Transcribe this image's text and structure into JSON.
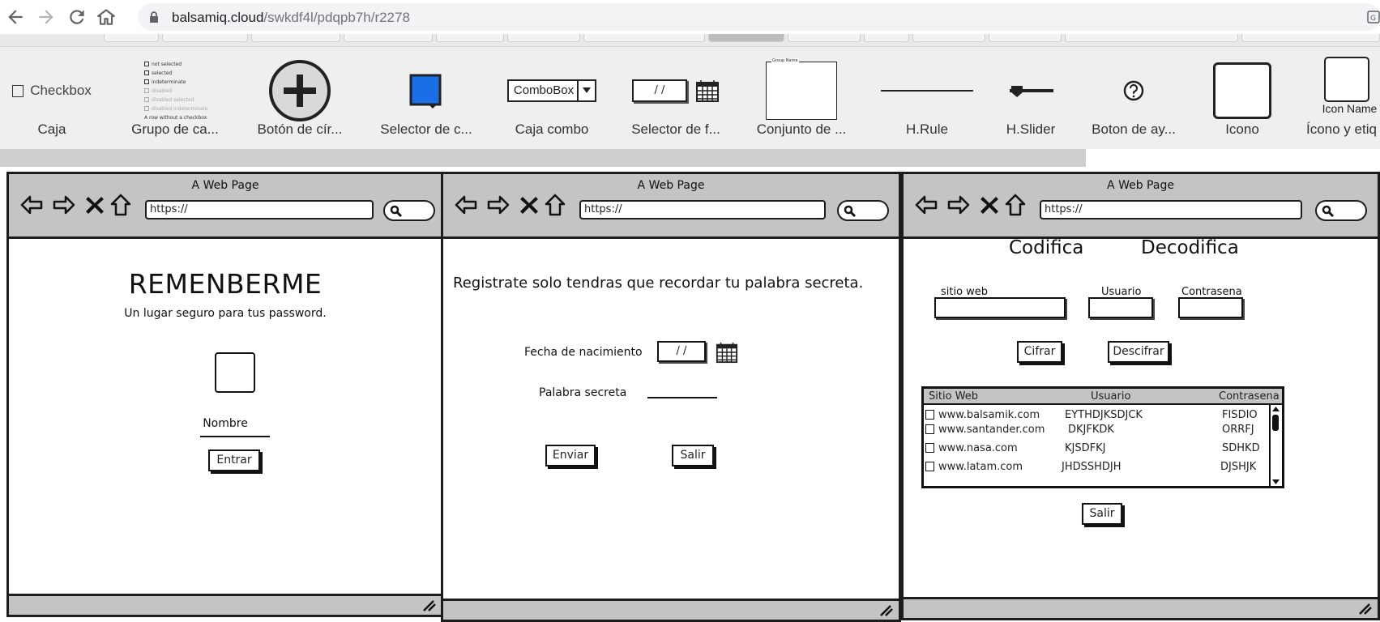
{
  "browser": {
    "url_host": "balsamiq.cloud",
    "url_path": "/swkdf4l/pdqpb7h/r2278"
  },
  "library": {
    "items": [
      {
        "label": "Caja",
        "preview_text": "Checkbox"
      },
      {
        "label": "Grupo de ca...",
        "preview_lines": [
          "not selected",
          "selected",
          "indeterminate",
          "disabled",
          "disabled selected",
          "disabled indeterminate",
          "A row without a checkbox"
        ]
      },
      {
        "label": "Botón de cír..."
      },
      {
        "label": "Selector de c..."
      },
      {
        "label": "Caja combo",
        "preview_text": "ComboBox"
      },
      {
        "label": "Selector de f...",
        "preview_text": "/ /"
      },
      {
        "label": "Conjunto de ...",
        "preview_text": "Group Name"
      },
      {
        "label": "H.Rule"
      },
      {
        "label": "H.Slider"
      },
      {
        "label": "Boton de ay..."
      },
      {
        "label": "Icono"
      },
      {
        "label": "Ícono y etiq",
        "preview_text": "Icon Name"
      }
    ]
  },
  "frames": [
    {
      "title": "A Web Page",
      "url": "https://",
      "heading": "REMENBERME",
      "subheading": "Un lugar seguro para tus password.",
      "name_label": "Nombre",
      "enter_button": "Entrar"
    },
    {
      "title": "A Web Page",
      "url": "https://",
      "intro": "Registrate solo tendras que recordar tu palabra secreta.",
      "birth_label": "Fecha de nacimiento",
      "date_value": "/ /",
      "secret_label": "Palabra secreta",
      "send_button": "Enviar",
      "exit_button": "Salir"
    },
    {
      "title": "A Web Page",
      "url": "https://",
      "encode_title": "Codifica",
      "decode_title": "Decodifica",
      "site_label": "sitio web",
      "user_label": "Usuario",
      "password_label": "Contrasena",
      "encrypt_button": "Cifrar",
      "decrypt_button": "Descifrar",
      "exit_button": "Salir",
      "table": {
        "headers": [
          "Sitio Web",
          "Usuario",
          "Contrasena"
        ],
        "rows": [
          [
            "www.balsamik.com",
            "EYTHDJKSDJCK",
            "FISDIO"
          ],
          [
            "www.santander.com",
            "DKJFKDK",
            "ORRFJ"
          ],
          [
            "www.nasa.com",
            "KJSDFKJ",
            "SDHKD"
          ],
          [
            "www.latam.com",
            "JHDSSHDJH",
            "DJSHJK"
          ]
        ]
      }
    }
  ],
  "colors": {
    "chrome_bg": "#ffffff",
    "omnibox_bg": "#f1f3f4",
    "library_bg": "#efefef",
    "sketch_gray": "#c4c4c4",
    "sketch_ink": "#1d1d1d",
    "selector_blue": "#1a6ee6"
  }
}
